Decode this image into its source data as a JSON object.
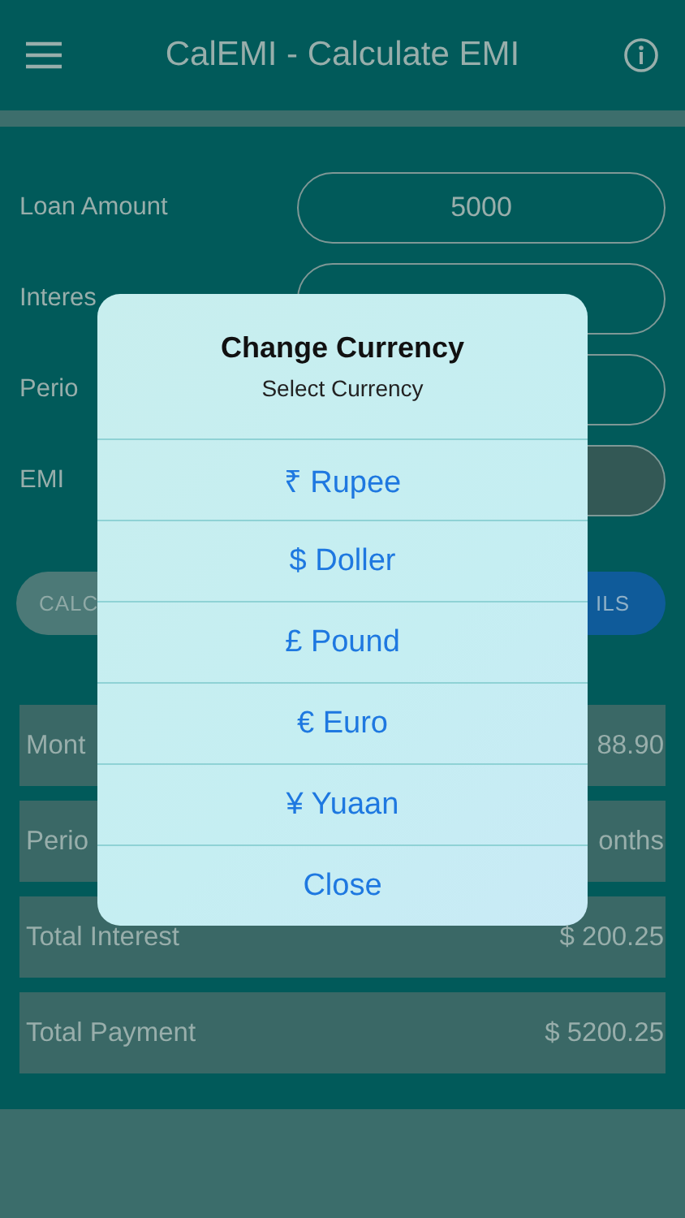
{
  "app_bar": {
    "title": "CalEMI - Calculate EMI"
  },
  "form": [
    {
      "label": "Loan Amount",
      "value": "5000",
      "disabled": false
    },
    {
      "label": "Interes",
      "disabled": false
    },
    {
      "label": "Perio",
      "disabled": false
    },
    {
      "label": "EMI",
      "disabled": true
    }
  ],
  "buttons": [
    {
      "label": "CALC",
      "kind": "secondary"
    },
    {
      "label": "ILS",
      "kind": "primary"
    }
  ],
  "results": [
    {
      "label": "Mont",
      "value": "88.90"
    },
    {
      "label": "Perio",
      "value": "onths"
    },
    {
      "label": "Total Interest",
      "value": "$ 200.25"
    },
    {
      "label": "Total Payment",
      "value": "$ 5200.25"
    }
  ],
  "dialog": {
    "title": "Change Currency",
    "subtitle": "Select Currency",
    "options": [
      "₹ Rupee",
      "$ Doller",
      "£ Pound",
      "€ Euro",
      "¥ Yuaan",
      "Close"
    ]
  }
}
